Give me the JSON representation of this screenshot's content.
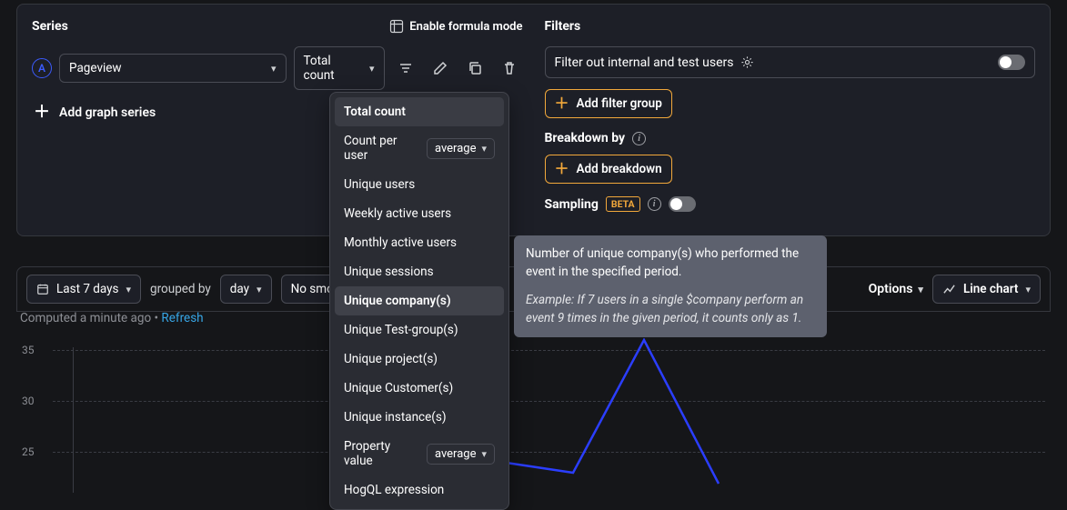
{
  "series": {
    "label": "Series",
    "formula_mode_label": "Enable formula mode",
    "badge": "A",
    "event": "Pageview",
    "agg": "Total count",
    "add_label": "Add graph series"
  },
  "dropdown": {
    "items": [
      {
        "label": "Total count"
      },
      {
        "label": "Count per user",
        "sub": "average"
      },
      {
        "label": "Unique users"
      },
      {
        "label": "Weekly active users"
      },
      {
        "label": "Monthly active users"
      },
      {
        "label": "Unique sessions"
      },
      {
        "label": "Unique company(s)"
      },
      {
        "label": "Unique Test-group(s)"
      },
      {
        "label": "Unique project(s)"
      },
      {
        "label": "Unique Customer(s)"
      },
      {
        "label": "Unique instance(s)"
      },
      {
        "label": "Property value",
        "sub": "average"
      },
      {
        "label": "HogQL expression"
      }
    ]
  },
  "tooltip": {
    "text": "Number of unique company(s) who performed the event in the specified period.",
    "example": "Example: If 7 users in a single $company perform an event 9 times in the given period, it counts only as 1."
  },
  "filters": {
    "label": "Filters",
    "internal": "Filter out internal and test users",
    "add_group": "Add filter group",
    "breakdown_label": "Breakdown by",
    "add_breakdown": "Add breakdown",
    "sampling_label": "Sampling",
    "sampling_badge": "BETA"
  },
  "controls": {
    "date_range": "Last 7 days",
    "grouped_by": "grouped by",
    "interval": "day",
    "smoothing": "No smoothing",
    "options": "Options",
    "chart_type": "Line chart",
    "computed": "Computed a minute ago",
    "refresh": "Refresh"
  },
  "chart_data": {
    "type": "line",
    "ylim": [
      20,
      40
    ],
    "y_ticks": [
      25,
      30,
      35
    ],
    "series": [
      {
        "name": "Pageview",
        "color": "#2b3eff",
        "values": [
          24,
          23,
          36,
          22
        ]
      }
    ]
  }
}
